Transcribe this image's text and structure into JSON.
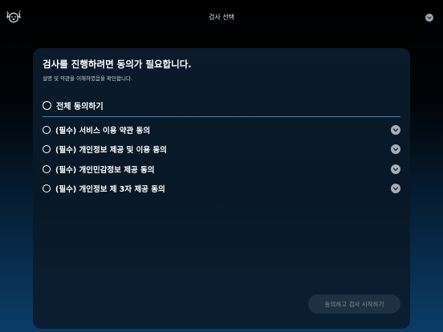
{
  "header": {
    "title": "검사 선택",
    "logo_icon": "dog-face-icon",
    "menu_icon": "chevron-down-icon"
  },
  "card": {
    "heading": "검사를 진행하려면 동의가 필요합니다.",
    "subheading": "설명 및 약관을 이해하였음을 확인합니다.",
    "agree_all_label": "전체 동의하기",
    "items": [
      {
        "label": "(필수) 서비스 이용 약관 동의"
      },
      {
        "label": "(필수) 개인정보 제공 및 이용 동의"
      },
      {
        "label": "(필수) 개인민감정보 제공 동의"
      },
      {
        "label": "(필수) 개인정보 제 3자 제공 동의"
      }
    ],
    "start_button_label": "동의하고 검사 시작하기"
  },
  "colors": {
    "accent_line": "#3b84c8",
    "button_bg": "#1e3143",
    "button_text": "#7f8d9b"
  }
}
